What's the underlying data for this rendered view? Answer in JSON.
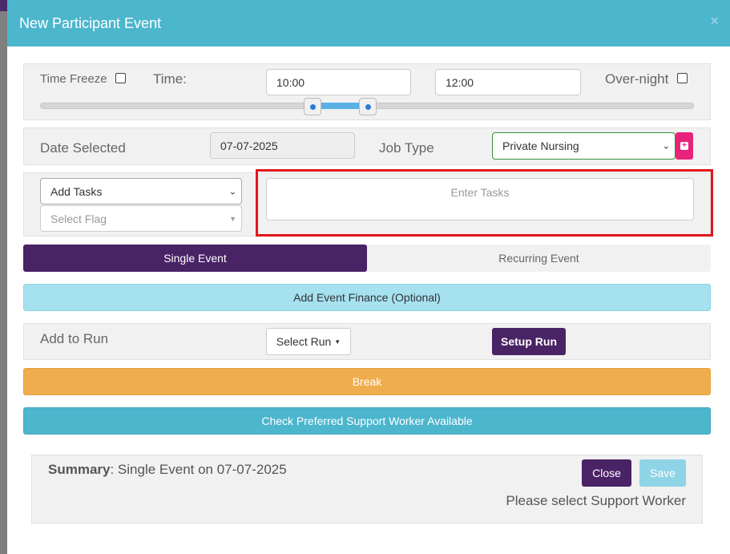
{
  "modal": {
    "title": "New Participant Event",
    "close_glyph": "×"
  },
  "time": {
    "freeze_label": "Time Freeze",
    "time_label": "Time:",
    "start": "10:00",
    "end": "12:00",
    "overnight_label": "Over-night",
    "slider_icon": "range-slider"
  },
  "date": {
    "label": "Date Selected",
    "value": "07-07-2025",
    "job_type_label": "Job Type",
    "job_type_value": "Private Nursing"
  },
  "tasks": {
    "add_tasks_value": "Add Tasks",
    "flag_placeholder": "Select Flag",
    "enter_placeholder": "Enter Tasks"
  },
  "event_type": {
    "single": "Single Event",
    "recurring": "Recurring Event"
  },
  "finance": {
    "label": "Add Event Finance (Optional)"
  },
  "run": {
    "label": "Add to Run",
    "select_label": "Select Run",
    "setup_label": "Setup Run"
  },
  "break": {
    "label": "Break"
  },
  "check_worker": {
    "label": "Check Preferred Support Worker Available"
  },
  "summary": {
    "label": "Summary",
    "text": ": Single Event on 07-07-2025",
    "close_label": "Close",
    "save_label": "Save",
    "warning": "Please select Support Worker"
  },
  "colors": {
    "header": "#4cb6cd",
    "primary_purple": "#4a2266",
    "finance": "#a6e1ef",
    "break": "#f0ad4e",
    "check": "#4cb6cd",
    "highlight": "#e0161b"
  }
}
